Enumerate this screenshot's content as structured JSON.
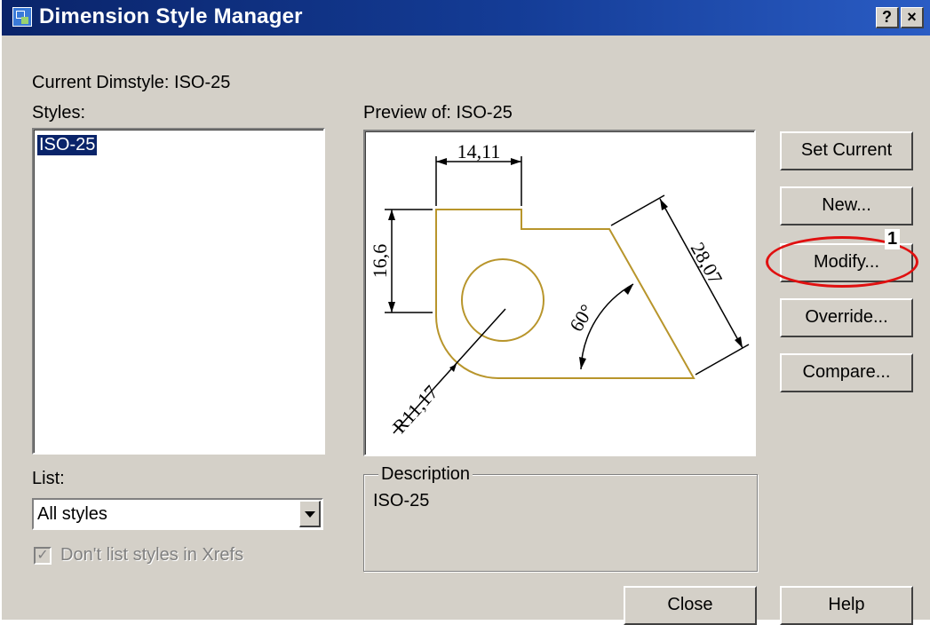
{
  "window": {
    "title": "Dimension Style Manager",
    "help_glyph": "?",
    "close_glyph": "×"
  },
  "current_dimstyle": "Current Dimstyle: ISO-25",
  "styles": {
    "label": "Styles:",
    "items": [
      "ISO-25"
    ],
    "selected": "ISO-25"
  },
  "preview": {
    "label": "Preview of: ISO-25",
    "dims": {
      "top": "14,11",
      "left": "16,6",
      "diagonal": "28,07",
      "angle": "60°",
      "radius": "R11,17"
    }
  },
  "buttons": {
    "set_current": "Set Current",
    "new": "New...",
    "modify": "Modify...",
    "override": "Override...",
    "compare": "Compare...",
    "close": "Close",
    "help": "Help"
  },
  "list": {
    "label": "List:",
    "selected": "All styles"
  },
  "xrefs_checkbox": {
    "label": "Don't list styles in Xrefs",
    "checked": true
  },
  "description": {
    "legend": "Description",
    "text": "ISO-25"
  },
  "annotation": {
    "number": "1",
    "color": "#e01010"
  }
}
